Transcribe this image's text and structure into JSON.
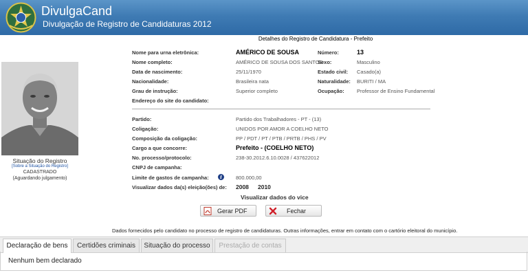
{
  "header": {
    "app_name": "DivulgaCand",
    "subtitle": "Divulgação de Registro de Candidaturas 2012"
  },
  "page_title": "Detalhes do Registro de Candidatura - Prefeito",
  "photo_caption": {
    "status_label": "Situação do Registro",
    "status_link": "[Sobre a Situação do Registro]",
    "status_value": "CADASTRADO",
    "status_note": "(Aguardando julgamento)"
  },
  "candidate": {
    "ballot_name_label": "Nome para urna eletrônica:",
    "ballot_name": "AMÉRICO DE SOUSA",
    "number_label": "Número:",
    "number": "13",
    "full_name_label": "Nome completo:",
    "full_name": "AMÉRICO DE SOUSA DOS SANTOS",
    "sex_label": "Sexo:",
    "sex": "Masculino",
    "birth_label": "Data de nascimento:",
    "birth": "25/11/1970",
    "civil_label": "Estado civil:",
    "civil": "Casado(a)",
    "nationality_label": "Nacionalidade:",
    "nationality": "Brasileira nata",
    "naturality_label": "Naturalidade:",
    "naturality": "BURITI / MA",
    "education_label": "Grau de instrução:",
    "education": "Superior completo",
    "occupation_label": "Ocupação:",
    "occupation": "Professor de Ensino Fundamental",
    "site_label": "Endereço do site do candidato:"
  },
  "election": {
    "party_label": "Partido:",
    "party": "Partido dos Trabalhadores - PT - (13)",
    "coalition_label": "Coligação:",
    "coalition": "UNIDOS POR AMOR A COELHO NETO",
    "composition_label": "Composição da coligação:",
    "composition": "PP / PDT / PT / PTB / PRTB / PHS / PV",
    "office_label": "Cargo a que concorre:",
    "office": "Prefeito - (COELHO NETO)",
    "process_label": "No. processo/protocolo:",
    "process": "238-30.2012.6.10.0028 / 437622012",
    "cnpj_label": "CNPJ de campanha:",
    "spending_label": "Limite de gastos de campanha:",
    "spending": "800.000,00",
    "view_data_label": "Visualizar dados da(s) eleição(ões) de:",
    "year_1": "2008",
    "year_2": "2010",
    "vice_link": "Visualizar dados do vice"
  },
  "buttons": {
    "pdf": "Gerar PDF",
    "close": "Fechar"
  },
  "footnote": "Dados fornecidos pelo candidato no processo de registro de candidaturas.  Outras informações, entrar em contato com o cartório eleitoral do município.",
  "tabs": [
    {
      "label": "Declaração de bens"
    },
    {
      "label": "Certidões criminais"
    },
    {
      "label": "Situação do processo"
    },
    {
      "label": "Prestação de contas"
    }
  ],
  "tab_content": "Nenhum bem declarado",
  "colors": {
    "header": "#3f7bb4",
    "link": "#1a4fa0"
  }
}
